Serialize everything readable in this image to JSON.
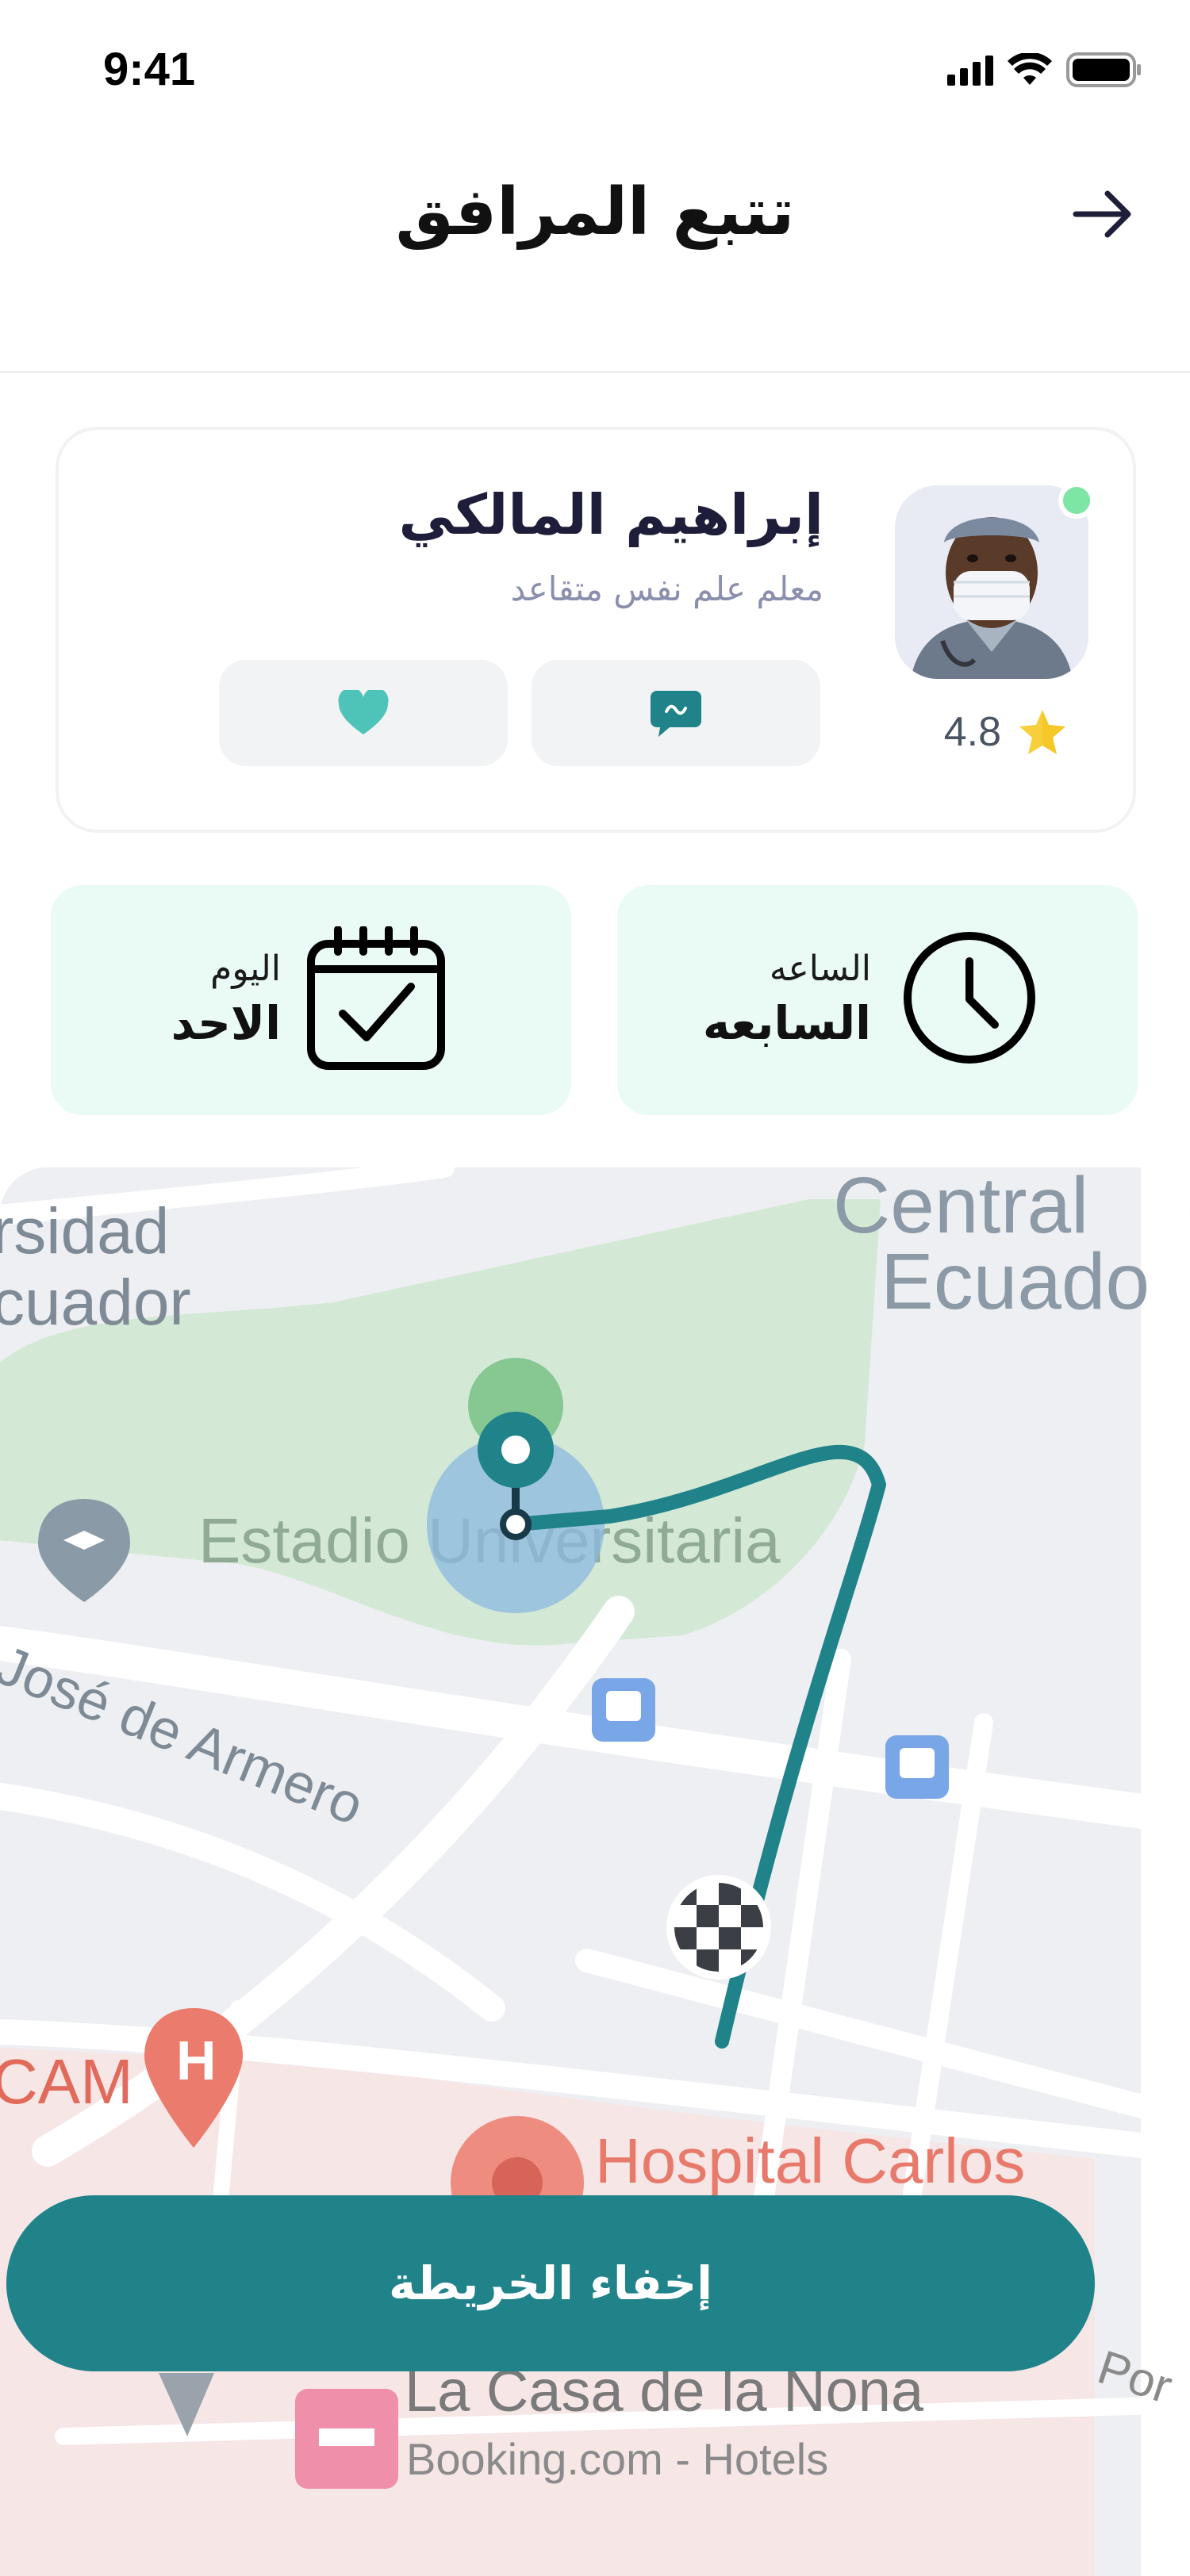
{
  "status_bar": {
    "time": "9:41"
  },
  "header": {
    "title": "تتبع المرافق"
  },
  "companion": {
    "name": "إبراهيم المالكي",
    "role": "معلم علم نفس متقاعد",
    "rating": "4.8"
  },
  "schedule": {
    "time_label": "الساعه",
    "time_value": "السابعه",
    "day_label": "اليوم",
    "day_value": "الاحد"
  },
  "map": {
    "labels": {
      "university": "rsidad\ncuador",
      "park_north": "Central\nEcuado",
      "stadium": "Estadio Universitaria",
      "street": "José de Armero",
      "cam": "CAM",
      "hospital": "Hospital Carlos",
      "hotel_name": "La Casa de la Nona",
      "hotel_sub": "Booking.com - Hotels",
      "corner": "Por"
    }
  },
  "actions": {
    "hide_map": "إخفاء الخريطة"
  },
  "colors": {
    "accent": "#20838a",
    "tile_bg": "#e9fbf4",
    "online": "#7ee6a4",
    "heart": "#4ec3b7"
  }
}
